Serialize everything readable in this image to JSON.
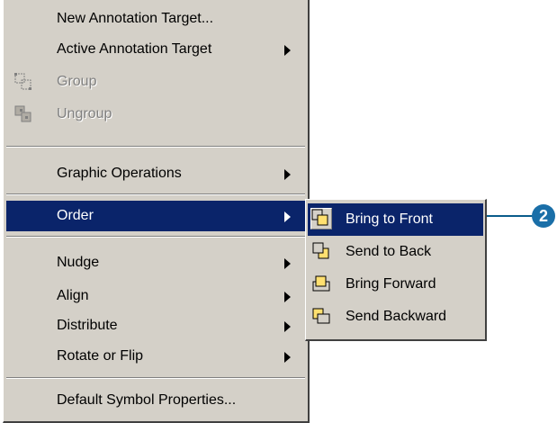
{
  "main_menu": {
    "items": [
      {
        "label": "New Annotation Target...",
        "submenu": false,
        "disabled": false
      },
      {
        "label": "Active Annotation Target",
        "submenu": true,
        "disabled": false
      },
      {
        "label": "Group",
        "submenu": false,
        "disabled": true,
        "icon": "group-icon"
      },
      {
        "label": "Ungroup",
        "submenu": false,
        "disabled": true,
        "icon": "ungroup-icon"
      },
      {
        "label": "Graphic Operations",
        "submenu": true,
        "disabled": false
      },
      {
        "label": "Order",
        "submenu": true,
        "disabled": false,
        "selected": true
      },
      {
        "label": "Nudge",
        "submenu": true,
        "disabled": false
      },
      {
        "label": "Align",
        "submenu": true,
        "disabled": false
      },
      {
        "label": "Distribute",
        "submenu": true,
        "disabled": false
      },
      {
        "label": "Rotate or Flip",
        "submenu": true,
        "disabled": false
      },
      {
        "label": "Default Symbol Properties...",
        "submenu": false,
        "disabled": false
      }
    ]
  },
  "order_submenu": {
    "items": [
      {
        "label": "Bring to Front",
        "icon": "bring-to-front-icon",
        "selected": true
      },
      {
        "label": "Send to Back",
        "icon": "send-to-back-icon"
      },
      {
        "label": "Bring Forward",
        "icon": "bring-forward-icon"
      },
      {
        "label": "Send Backward",
        "icon": "send-backward-icon"
      }
    ]
  },
  "callout": {
    "number": "2"
  },
  "colors": {
    "menu_bg": "#d4d0c8",
    "highlight": "#0a246a",
    "callout": "#1a6fa8"
  }
}
